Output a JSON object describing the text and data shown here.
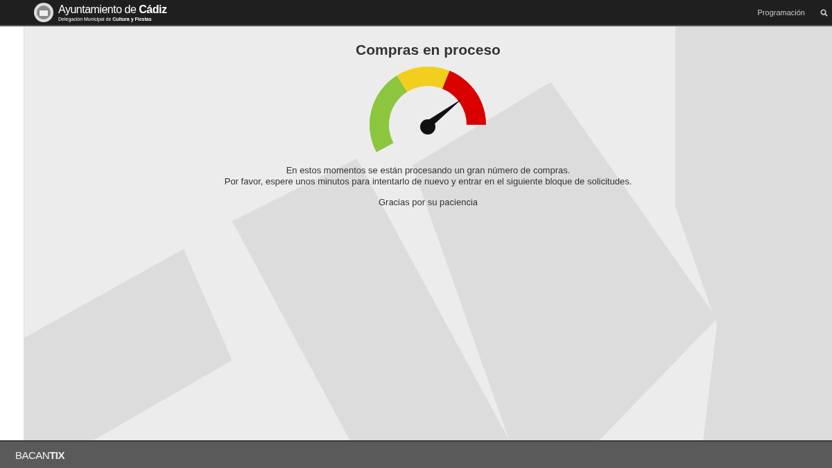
{
  "header": {
    "title": "Ayuntamiento de **Cádiz**",
    "subtitle": "Delegación Municipal de **Cultura y Fiestas**",
    "nav": [
      {
        "label": "Programación"
      }
    ]
  },
  "main": {
    "heading": "Compras en proceso",
    "message_lines": [
      "En estos momentos se están procesando un gran número de compras.",
      "Por favor, espere unos minutos para intentarlo de nuevo y entrar en el siguiente bloque de solicitudes."
    ],
    "thanks": "Gracias por su paciencia"
  },
  "footer": {
    "brand": "BACAN**TIX**"
  }
}
